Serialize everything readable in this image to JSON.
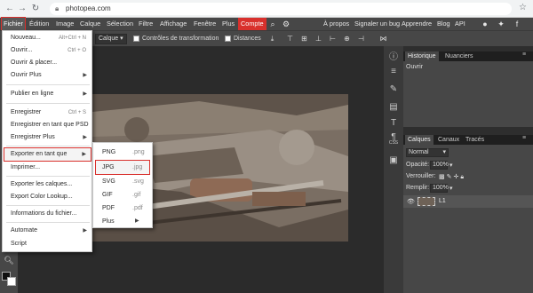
{
  "browser": {
    "url": "photopea.com",
    "back_icon": "arrow-left-icon",
    "forward_icon": "arrow-right-icon",
    "reload_icon": "reload-icon"
  },
  "menubar": {
    "items": [
      "Fichier",
      "Édition",
      "Image",
      "Calque",
      "Sélection",
      "Filtre",
      "Affichage",
      "Fenêtre",
      "Plus",
      "Compte"
    ],
    "active": "Fichier",
    "right_links": [
      "À propos",
      "Signaler un bug",
      "Apprendre",
      "Blog",
      "API"
    ]
  },
  "options": {
    "select_value": "Calque",
    "transform_label": "Contrôles de transformation",
    "distances_label": "Distances"
  },
  "file_menu": {
    "items": [
      {
        "label": "Nouveau...",
        "shortcut": "Alt+Ctrl + N",
        "arrow": ""
      },
      {
        "label": "Ouvrir...",
        "shortcut": "Ctrl + O",
        "arrow": ""
      },
      {
        "label": "Ouvrir & placer...",
        "shortcut": "",
        "arrow": ""
      },
      {
        "label": "Ouvrir Plus",
        "shortcut": "",
        "arrow": "▶"
      },
      {
        "label": "Publier en ligne",
        "shortcut": "",
        "arrow": "▶"
      },
      {
        "label": "Enregistrer",
        "shortcut": "Ctrl + S",
        "arrow": ""
      },
      {
        "label": "Enregistrer en tant que PSD",
        "shortcut": "",
        "arrow": ""
      },
      {
        "label": "Enregistrer Plus",
        "shortcut": "",
        "arrow": "▶"
      },
      {
        "label": "Exporter en tant que",
        "shortcut": "",
        "arrow": "▶"
      },
      {
        "label": "Imprimer...",
        "shortcut": "",
        "arrow": ""
      },
      {
        "label": "Exporter les calques...",
        "shortcut": "",
        "arrow": ""
      },
      {
        "label": "Export Color Lookup...",
        "shortcut": "",
        "arrow": ""
      },
      {
        "label": "Informations du fichier...",
        "shortcut": "",
        "arrow": ""
      },
      {
        "label": "Automate",
        "shortcut": "",
        "arrow": "▶"
      },
      {
        "label": "Script",
        "shortcut": "",
        "arrow": ""
      }
    ],
    "highlighted": "Exporter en tant que"
  },
  "export_submenu": {
    "items": [
      {
        "label": "PNG",
        "ext": ".png",
        "arrow": ""
      },
      {
        "label": "JPG",
        "ext": ".jpg",
        "arrow": ""
      },
      {
        "label": "SVG",
        "ext": ".svg",
        "arrow": ""
      },
      {
        "label": "GIF",
        "ext": ".gif",
        "arrow": ""
      },
      {
        "label": "PDF",
        "ext": ".pdf",
        "arrow": ""
      },
      {
        "label": "Plus",
        "ext": "",
        "arrow": "▶"
      }
    ],
    "highlighted": "JPG"
  },
  "history_panel": {
    "tabs": [
      "Historique",
      "Nuanciers"
    ],
    "entries": [
      "Ouvrir"
    ]
  },
  "layers_panel": {
    "tabs": [
      "Calques",
      "Canaux",
      "Tracés"
    ],
    "blend_mode": "Normal",
    "opacity_label": "Opacité:",
    "opacity_value": "100%",
    "lock_label": "Verrouiller:",
    "fill_label": "Remplir:",
    "fill_value": "100%",
    "layer_name": "L1"
  },
  "right_toolbar": {
    "css_label": "CSS"
  },
  "colors": {
    "accent": "#d9302c",
    "menubar": "#474747",
    "workspace": "#2b2b2b",
    "panel": "#474747"
  }
}
